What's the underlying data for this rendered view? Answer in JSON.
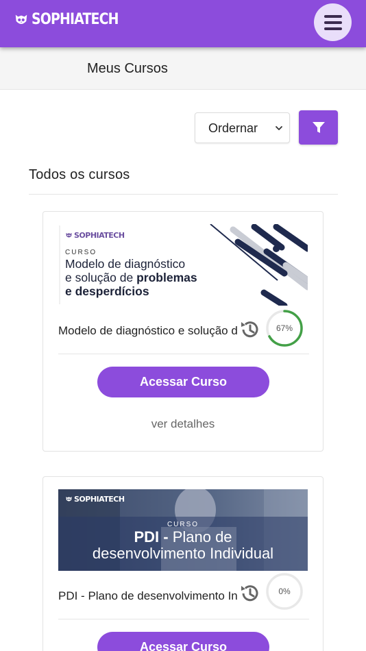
{
  "header": {
    "brand": "SOPHIATECH",
    "logo_icon": "owl-icon",
    "menu_icon": "hamburger-icon",
    "accent_color": "#8c4cdc"
  },
  "subheader": {
    "title": "Meus Cursos"
  },
  "toolbar": {
    "order_label": "Ordernar",
    "filter_icon": "filter-icon"
  },
  "section": {
    "title": "Todos os cursos"
  },
  "courses": [
    {
      "banner_brand": "SOPHIATECH",
      "banner_kicker": "CURSO",
      "banner_title_line1": "Modelo de diagnóstico",
      "banner_title_line2_plain": "e solução de ",
      "banner_title_line2_bold": "problemas",
      "banner_title_line3_bold": "e desperdícios",
      "name": "Modelo de diagnóstico e solução de problemas e desperdícios",
      "progress": 67,
      "progress_label": "67%",
      "button_label": "Acessar Curso",
      "details_label": "ver detalhes"
    },
    {
      "banner_brand": "SOPHIATECH",
      "banner_kicker": "CURSO",
      "banner_title_bold": "PDI -",
      "banner_title_plain": " Plano de",
      "banner_title_line2": "desenvolvimento Individual",
      "name": "PDI - Plano de desenvolvimento Individual",
      "progress": 0,
      "progress_label": "0%",
      "button_label": "Acessar Curso"
    }
  ]
}
